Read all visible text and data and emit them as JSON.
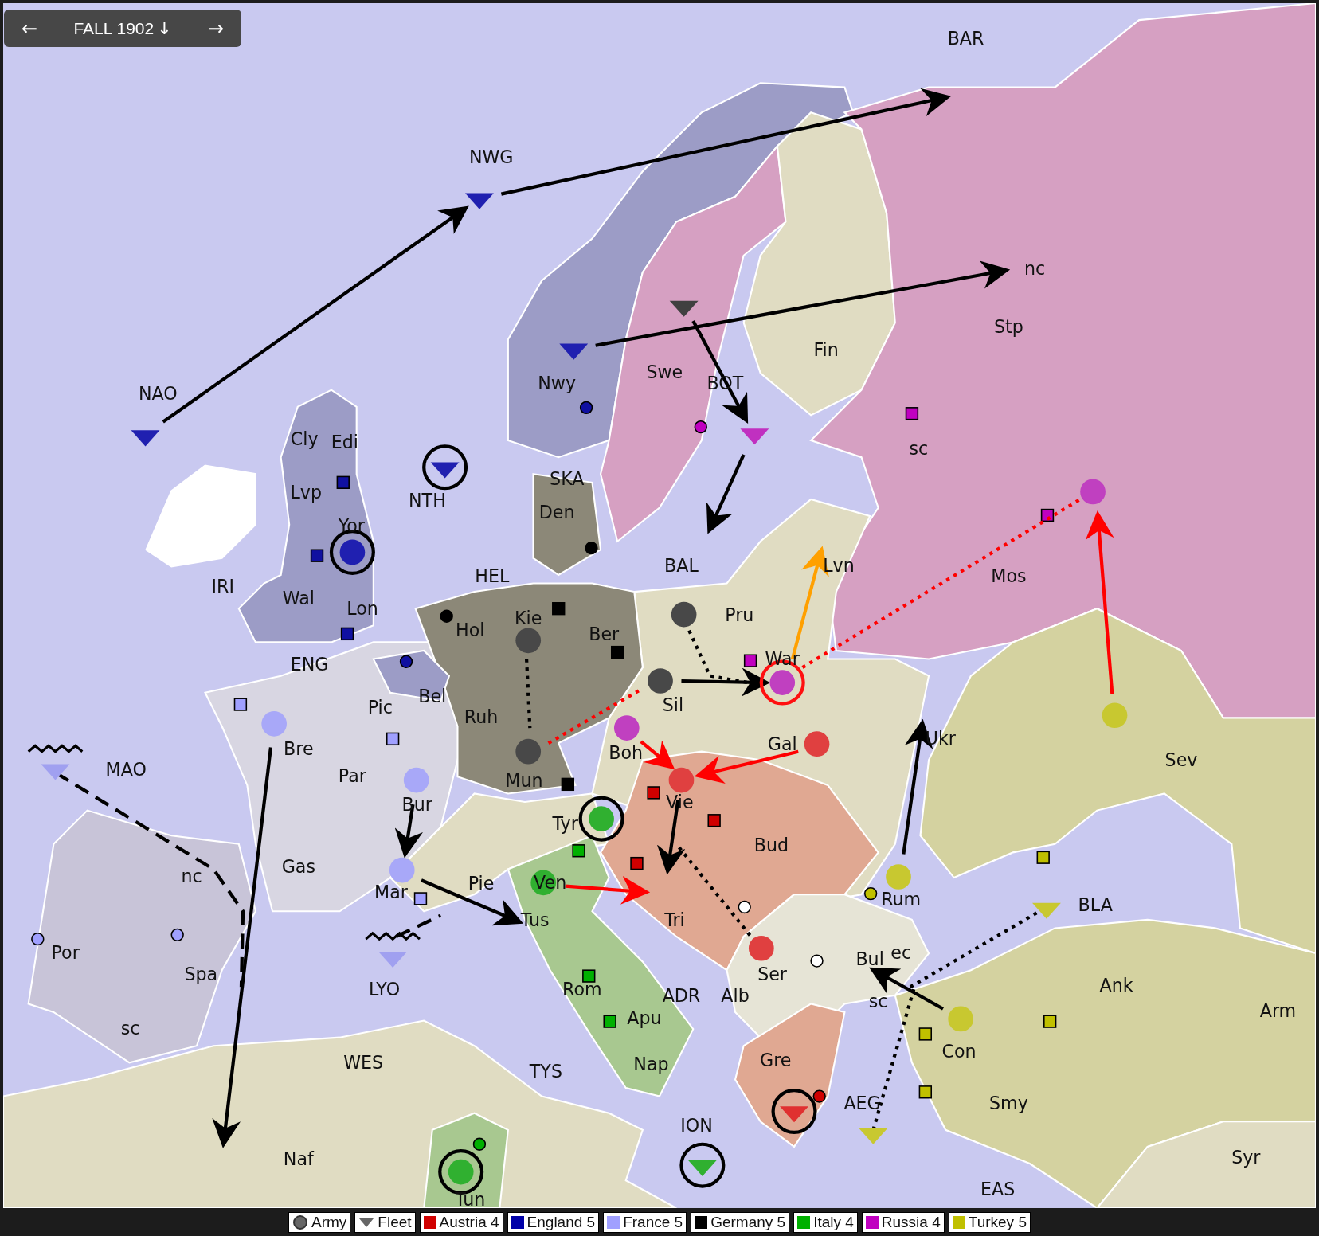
{
  "phase_bar": {
    "prev": "←",
    "title": "FALL 1902",
    "phase_icon": "↓",
    "next": "→"
  },
  "labels": [
    "BAR",
    "NWG",
    "NAO",
    "Nwy",
    "Swe",
    "BOT",
    "Fin",
    "Stp",
    "nc",
    "sc",
    "Cly",
    "Edi",
    "Lvp",
    "NTH",
    "SKA",
    "Den",
    "IRI",
    "Wal",
    "Yor",
    "Lon",
    "HEL",
    "BAL",
    "Lvn",
    "Mos",
    "Hol",
    "Kie",
    "Ber",
    "Pru",
    "War",
    "ENG",
    "Bel",
    "Pic",
    "Ruh",
    "Sil",
    "Bre",
    "MAO",
    "Par",
    "Boh",
    "Gal",
    "Ukr",
    "Sev",
    "Mun",
    "Bur",
    "Vie",
    "Tyr",
    "Bud",
    "nc",
    "Gas",
    "Mar",
    "Pie",
    "Ven",
    "Rum",
    "BLA",
    "Tus",
    "Tri",
    "Por",
    "Spa",
    "LYO",
    "Ser",
    "Bul",
    "ec",
    "sc",
    "Ank",
    "Arm",
    "Rom",
    "ADR",
    "Alb",
    "Apu",
    "sc",
    "Con",
    "WES",
    "TYS",
    "Nap",
    "Gre",
    "AEG",
    "Smy",
    "ION",
    "Naf",
    "Syr",
    "EAS",
    "Tun"
  ],
  "centers": [
    {
      "kind": "square",
      "color": "#1010a0"
    },
    {
      "kind": "square",
      "color": "#1010a0"
    },
    {
      "kind": "square",
      "color": "#1010a0"
    },
    {
      "kind": "square",
      "color": "#a0a0ff"
    },
    {
      "kind": "square",
      "color": "#a0a0ff"
    },
    {
      "kind": "square",
      "color": "#a0a0ff"
    },
    {
      "kind": "square",
      "color": "#000000"
    },
    {
      "kind": "square",
      "color": "#000000"
    },
    {
      "kind": "square",
      "color": "#000000"
    },
    {
      "kind": "square",
      "color": "#c000c0"
    },
    {
      "kind": "square",
      "color": "#c000c0"
    },
    {
      "kind": "square",
      "color": "#c000c0"
    },
    {
      "kind": "square",
      "color": "#d00000"
    },
    {
      "kind": "square",
      "color": "#d00000"
    },
    {
      "kind": "square",
      "color": "#d00000"
    },
    {
      "kind": "square",
      "color": "#00b000"
    },
    {
      "kind": "square",
      "color": "#00b000"
    },
    {
      "kind": "square",
      "color": "#00b000"
    },
    {
      "kind": "square",
      "color": "#c0c000"
    },
    {
      "kind": "square",
      "color": "#c0c000"
    },
    {
      "kind": "square",
      "color": "#c0c000"
    },
    {
      "kind": "square",
      "color": "#c0c000"
    },
    {
      "kind": "dot",
      "color": "#1010a0"
    },
    {
      "kind": "dot",
      "color": "#c000c0"
    },
    {
      "kind": "dot",
      "color": "#000000"
    },
    {
      "kind": "dot",
      "color": "#000000"
    },
    {
      "kind": "dot",
      "color": "#1010a0"
    },
    {
      "kind": "dot",
      "color": "#a0a0ff"
    },
    {
      "kind": "dot",
      "color": "#a0a0ff"
    },
    {
      "kind": "dot",
      "color": "#c0c000"
    },
    {
      "kind": "dot",
      "color": "#d00000"
    },
    {
      "kind": "dot",
      "color": "#00b000"
    },
    {
      "kind": "dot",
      "color": "#ffffff"
    },
    {
      "kind": "dot",
      "color": "#ffffff"
    }
  ],
  "units": [
    {
      "kind": "fleet",
      "color": "#2020b0",
      "circled": false,
      "contested": false,
      "dislodged": false
    },
    {
      "kind": "fleet",
      "color": "#2020b0",
      "circled": false,
      "contested": false,
      "dislodged": false
    },
    {
      "kind": "fleet",
      "color": "#2020b0",
      "circled": false,
      "contested": false,
      "dislodged": false
    },
    {
      "kind": "fleet",
      "color": "#2020b0",
      "circled": true,
      "contested": false,
      "dislodged": false
    },
    {
      "kind": "fleet",
      "color": "#404040",
      "circled": false,
      "contested": false,
      "dislodged": false
    },
    {
      "kind": "fleet",
      "color": "#c030c0",
      "circled": false,
      "contested": false,
      "dislodged": false
    },
    {
      "kind": "fleet",
      "color": "#a0a0f0",
      "circled": false,
      "contested": false,
      "dislodged": true
    },
    {
      "kind": "fleet",
      "color": "#a0a0f0",
      "circled": false,
      "contested": false,
      "dislodged": true
    },
    {
      "kind": "fleet",
      "color": "#c8c830",
      "circled": false,
      "contested": false,
      "dislodged": false
    },
    {
      "kind": "fleet",
      "color": "#c8c830",
      "circled": false,
      "contested": false,
      "dislodged": false
    },
    {
      "kind": "fleet",
      "color": "#30b030",
      "circled": true,
      "contested": false,
      "dislodged": false
    },
    {
      "kind": "fleet",
      "color": "#e03030",
      "circled": true,
      "contested": false,
      "dislodged": false
    },
    {
      "kind": "army",
      "color": "#2020b0",
      "circled": true,
      "contested": false,
      "dislodged": false
    },
    {
      "kind": "army",
      "color": "#a8a8f8",
      "circled": false,
      "contested": false,
      "dislodged": false
    },
    {
      "kind": "army",
      "color": "#a8a8f8",
      "circled": false,
      "contested": false,
      "dislodged": false
    },
    {
      "kind": "army",
      "color": "#a8a8f8",
      "circled": false,
      "contested": false,
      "dislodged": false
    },
    {
      "kind": "army",
      "color": "#484848",
      "circled": false,
      "contested": false,
      "dislodged": false
    },
    {
      "kind": "army",
      "color": "#484848",
      "circled": false,
      "contested": false,
      "dislodged": false
    },
    {
      "kind": "army",
      "color": "#484848",
      "circled": false,
      "contested": false,
      "dislodged": false
    },
    {
      "kind": "army",
      "color": "#484848",
      "circled": false,
      "contested": false,
      "dislodged": false
    },
    {
      "kind": "army",
      "color": "#c040c0",
      "circled": false,
      "contested": false,
      "dislodged": false
    },
    {
      "kind": "army",
      "color": "#c040c0",
      "circled": false,
      "contested": true,
      "dislodged": false
    },
    {
      "kind": "army",
      "color": "#c040c0",
      "circled": false,
      "contested": false,
      "dislodged": false
    },
    {
      "kind": "army",
      "color": "#c8c830",
      "circled": false,
      "contested": false,
      "dislodged": false
    },
    {
      "kind": "army",
      "color": "#c8c830",
      "circled": false,
      "contested": false,
      "dislodged": false
    },
    {
      "kind": "army",
      "color": "#c8c830",
      "circled": false,
      "contested": false,
      "dislodged": false
    },
    {
      "kind": "army",
      "color": "#e04040",
      "circled": false,
      "contested": false,
      "dislodged": false
    },
    {
      "kind": "army",
      "color": "#e04040",
      "circled": false,
      "contested": false,
      "dislodged": false
    },
    {
      "kind": "army",
      "color": "#e04040",
      "circled": false,
      "contested": false,
      "dislodged": false
    },
    {
      "kind": "army",
      "color": "#30b030",
      "circled": true,
      "contested": false,
      "dislodged": false
    },
    {
      "kind": "army",
      "color": "#30b030",
      "circled": false,
      "contested": false,
      "dislodged": false
    },
    {
      "kind": "army",
      "color": "#30b030",
      "circled": true,
      "contested": false,
      "dislodged": false
    }
  ],
  "orders": [
    {
      "kind": "move",
      "color": "#000000"
    },
    {
      "kind": "move",
      "color": "#000000"
    },
    {
      "kind": "move",
      "color": "#000000"
    },
    {
      "kind": "move",
      "color": "#000000"
    },
    {
      "kind": "move",
      "color": "#000000"
    },
    {
      "kind": "move",
      "color": "#000000"
    },
    {
      "kind": "retreat",
      "color": "#000000"
    },
    {
      "kind": "retreat",
      "color": "#000000"
    },
    {
      "kind": "move",
      "color": "#000000"
    },
    {
      "kind": "move",
      "color": "#000000"
    },
    {
      "kind": "support",
      "color": "#000000"
    },
    {
      "kind": "move",
      "color": "#000000"
    },
    {
      "kind": "support",
      "color": "#ff0000"
    },
    {
      "kind": "support",
      "color": "#000000"
    },
    {
      "kind": "move",
      "color": "#ffa000"
    },
    {
      "kind": "support",
      "color": "#ff0000"
    },
    {
      "kind": "move",
      "color": "#ff0000"
    },
    {
      "kind": "move",
      "color": "#ff0000"
    },
    {
      "kind": "move",
      "color": "#ff0000"
    },
    {
      "kind": "move",
      "color": "#000000"
    },
    {
      "kind": "move",
      "color": "#ff0000"
    },
    {
      "kind": "support",
      "color": "#000000"
    },
    {
      "kind": "move",
      "color": "#000000"
    },
    {
      "kind": "move",
      "color": "#000000"
    },
    {
      "kind": "support",
      "color": "#000000"
    },
    {
      "kind": "support",
      "color": "#000000"
    }
  ],
  "legend": [
    {
      "kind": "army",
      "label": "Army"
    },
    {
      "kind": "fleet",
      "label": "Fleet"
    },
    {
      "kind": "power",
      "label": "Austria 4",
      "color": "#d00000"
    },
    {
      "kind": "power",
      "label": "England 5",
      "color": "#0000a8"
    },
    {
      "kind": "power",
      "label": "France 5",
      "color": "#a0a0ff"
    },
    {
      "kind": "power",
      "label": "Germany 5",
      "color": "#000000"
    },
    {
      "kind": "power",
      "label": "Italy 4",
      "color": "#00b000"
    },
    {
      "kind": "power",
      "label": "Russia 4",
      "color": "#c000c0"
    },
    {
      "kind": "power",
      "label": "Turkey 5",
      "color": "#c0c000"
    }
  ]
}
